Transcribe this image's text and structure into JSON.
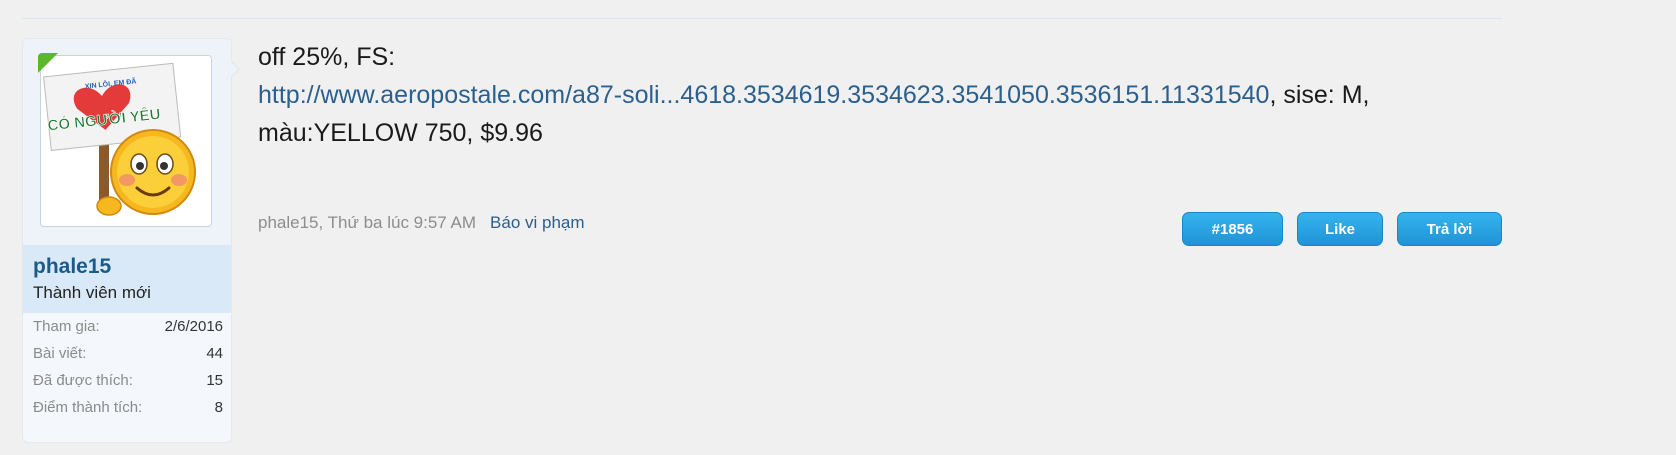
{
  "user": {
    "username": "phale15",
    "title": "Thành viên mới",
    "avatar_sign_small": "XIN LỖI, EM ĐÃ",
    "avatar_sign_big": "CÓ NGƯỜI YÊU",
    "stats": [
      {
        "label": "Tham gia:",
        "value": "2/6/2016"
      },
      {
        "label": "Bài viết:",
        "value": "44"
      },
      {
        "label": "Đã được thích:",
        "value": "15"
      },
      {
        "label": "Điểm thành tích:",
        "value": "8"
      }
    ]
  },
  "message": {
    "line1": "off 25%, FS:",
    "link_text": "http://www.aeropostale.com/a87-soli...4618.3534619.3534623.3541050.3536151.11331540",
    "after_link": ", sise: M,",
    "line3": "màu:YELLOW 750, $9.96"
  },
  "meta": {
    "author_time": "phale15, Thứ ba lúc 9:57 AM",
    "report": "Báo vi phạm"
  },
  "actions": {
    "post_number": "#1856",
    "like": "Like",
    "reply": "Trả lời"
  },
  "colors": {
    "link": "#2a5f8e",
    "button": "#1f93d6",
    "online": "#5cb82a"
  }
}
